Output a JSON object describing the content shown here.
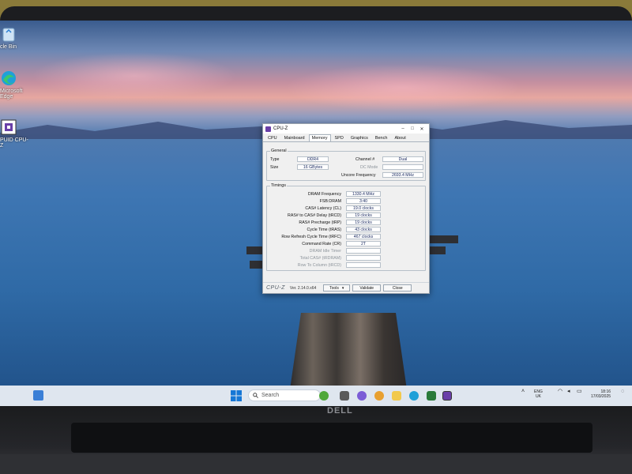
{
  "desktop": {
    "icons": [
      {
        "label": "cle Bin",
        "icon": "recycle-bin-icon"
      },
      {
        "label": "Microsoft Edge",
        "icon": "edge-icon"
      },
      {
        "label": "PUID CPU-Z",
        "icon": "cpuz-icon"
      }
    ]
  },
  "cpuz": {
    "title": "CPU-Z",
    "tabs": [
      "CPU",
      "Mainboard",
      "Memory",
      "SPD",
      "Graphics",
      "Bench",
      "About"
    ],
    "active_tab": "Memory",
    "general": {
      "title": "General",
      "type_label": "Type",
      "type_value": "DDR4",
      "size_label": "Size",
      "size_value": "16 GBytes",
      "channel_label": "Channel #",
      "channel_value": "Dual",
      "dc_mode_label": "DC Mode",
      "dc_mode_value": "",
      "uncore_label": "Uncore Frequency",
      "uncore_value": "2693.4 MHz"
    },
    "timings": {
      "title": "Timings",
      "rows": [
        {
          "label": "DRAM Frequency",
          "value": "1330.4 MHz",
          "dim": false
        },
        {
          "label": "FSB:DRAM",
          "value": "3:40",
          "dim": false
        },
        {
          "label": "CAS# Latency (CL)",
          "value": "19.0 clocks",
          "dim": false
        },
        {
          "label": "RAS# to CAS# Delay (tRCD)",
          "value": "19 clocks",
          "dim": false
        },
        {
          "label": "RAS# Precharge (tRP)",
          "value": "19 clocks",
          "dim": false
        },
        {
          "label": "Cycle Time (tRAS)",
          "value": "43 clocks",
          "dim": false
        },
        {
          "label": "Row Refresh Cycle Time (tRFC)",
          "value": "467 clocks",
          "dim": false
        },
        {
          "label": "Command Rate (CR)",
          "value": "2T",
          "dim": false
        },
        {
          "label": "DRAM Idle Timer",
          "value": "",
          "dim": true
        },
        {
          "label": "Total CAS# (tRDRAM)",
          "value": "",
          "dim": true
        },
        {
          "label": "Row To Column (tRCD)",
          "value": "",
          "dim": true
        }
      ]
    },
    "footer": {
      "logo": "CPU-Z",
      "version": "Ver. 2.14.0.x64",
      "tools_label": "Tools",
      "validate_label": "Validate",
      "close_label": "Close"
    }
  },
  "taskbar": {
    "search_placeholder": "Search",
    "tray": {
      "language": "ENG",
      "region": "UK",
      "time": "18:16",
      "date": "17/03/2025"
    }
  },
  "laptop": {
    "brand": "DELL"
  },
  "colors": {
    "taskbar_bg": "#dfe6ef",
    "window_bg": "#f0f0f0",
    "value_text": "#1a2a60"
  }
}
